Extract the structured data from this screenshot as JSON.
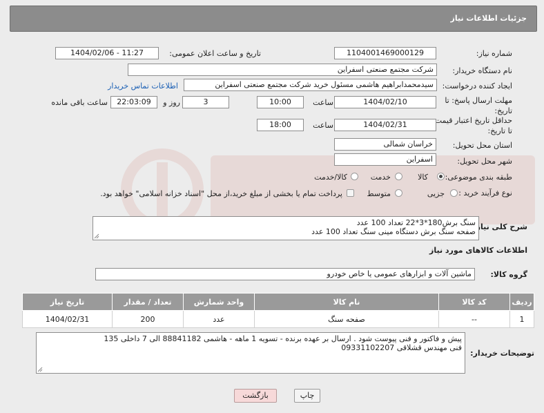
{
  "header": {
    "title": "جزئیات اطلاعات نیاز"
  },
  "fields": {
    "need_number_label": "شماره نیاز:",
    "need_number": "1104001469000129",
    "announce_label": "تاریخ و ساعت اعلان عمومی:",
    "announce_value": "1404/02/06 - 11:27",
    "buyer_label": "نام دستگاه خریدار:",
    "buyer_value": "شرکت مجتمع صنعتی اسفراین",
    "creator_label": "ایجاد کننده درخواست:",
    "creator_value": "سیدمحمدابراهیم هاشمی مسئول خرید شرکت مجتمع صنعتی اسفراین",
    "contact_link": "اطلاعات تماس خریدار",
    "deadline_label_1": "مهلت ارسال پاسخ: تا",
    "deadline_label_2": "تاریخ:",
    "deadline_date": "1404/02/10",
    "time_label": "ساعت",
    "deadline_time": "10:00",
    "days_value": "3",
    "days_label": "روز و",
    "remain_time": "22:03:09",
    "remain_label": "ساعت باقی مانده",
    "price_label_1": "حداقل تاریخ اعتبار قیمت:",
    "price_label_2": "تا تاریخ:",
    "price_date": "1404/02/31",
    "price_time_label": "ساعت",
    "price_time": "18:00",
    "province_label": "استان محل تحویل:",
    "province_value": "خراسان شمالی",
    "city_label": "شهر محل تحویل:",
    "city_value": "اسفراین",
    "category_label": "طبقه بندی موضوعی:",
    "category_options": [
      "کالا",
      "خدمت",
      "کالا/خدمت"
    ],
    "process_label": "نوع فرآیند خرید :",
    "process_options": [
      "جزیی",
      "متوسط"
    ],
    "payment_note": "پرداخت تمام یا بخشی از مبلغ خرید،از محل \"اسناد خزانه اسلامی\" خواهد بود."
  },
  "description": {
    "label": "شرح کلی نیاز:",
    "line1": "سنگ برش180*3*22 تعداد 100 عدد",
    "line2": "صفحه سنگ برش دستگاه مینی سنگ تعداد 100 عدد"
  },
  "goods_section": {
    "title": "اطلاعات کالاهای مورد نیاز",
    "group_label": "گروه کالا:",
    "group_value": "ماشین آلات و ابزارهای عمومی یا خاص خودرو"
  },
  "table": {
    "headers": [
      "ردیف",
      "کد کالا",
      "نام کالا",
      "واحد شمارش",
      "تعداد / مقدار",
      "تاریخ نیاز"
    ],
    "rows": [
      [
        "1",
        "--",
        "صفحه سنگ",
        "عدد",
        "200",
        "1404/02/31"
      ]
    ]
  },
  "notes": {
    "label": "توضیحات خریدار:",
    "line1": "پیش و فاکتور و فنی پیوست شود . ارسال بر عهده برنده - تسویه 1 ماهه - هاشمی 88841182 الی 7 داخلی 135",
    "line2": "فنی مهندس قشلاقی 09331102207"
  },
  "buttons": {
    "print": "چاپ",
    "back": "بازگشت"
  },
  "colors": {
    "header_bg": "#8c8c8c",
    "link": "#1a5fb4",
    "back_button_bg": "#f7d9d9"
  }
}
